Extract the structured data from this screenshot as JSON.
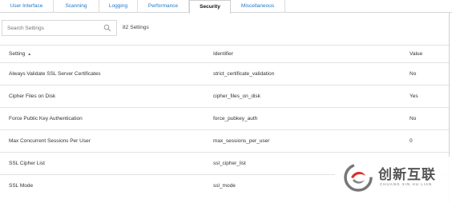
{
  "tabs": [
    {
      "label": "User Interface",
      "active": false
    },
    {
      "label": "Scanning",
      "active": false
    },
    {
      "label": "Logging",
      "active": false
    },
    {
      "label": "Performance",
      "active": false
    },
    {
      "label": "Security",
      "active": true
    },
    {
      "label": "Miscellaneous",
      "active": false
    }
  ],
  "search": {
    "placeholder": "Search Settings"
  },
  "settings_count": {
    "number": "82",
    "label": "Settings"
  },
  "table": {
    "headers": {
      "setting": "Setting",
      "identifier": "Identifier",
      "value": "Value"
    },
    "rows": [
      {
        "setting": "Always Validate SSL Server Certificates",
        "identifier": "strict_certificate_validation",
        "value": "No"
      },
      {
        "setting": "Cipher Files on Disk",
        "identifier": "cipher_files_on_disk",
        "value": "Yes"
      },
      {
        "setting": "Force Public Key Authentication",
        "identifier": "force_pubkey_auth",
        "value": "No"
      },
      {
        "setting": "Max Concurrent Sessions Per User",
        "identifier": "max_sessions_per_user",
        "value": "0"
      },
      {
        "setting": "SSL Cipher List",
        "identifier": "ssl_cipher_list",
        "value": ""
      },
      {
        "setting": "SSL Mode",
        "identifier": "ssl_mode",
        "value": ""
      }
    ]
  },
  "watermark": {
    "name_cn": "创新互联",
    "name_en": "CHUANG XIN HU LIAN"
  },
  "colors": {
    "tab_link": "#1f78c8",
    "border": "#e3e3e3",
    "logo_red": "#d9302c"
  }
}
